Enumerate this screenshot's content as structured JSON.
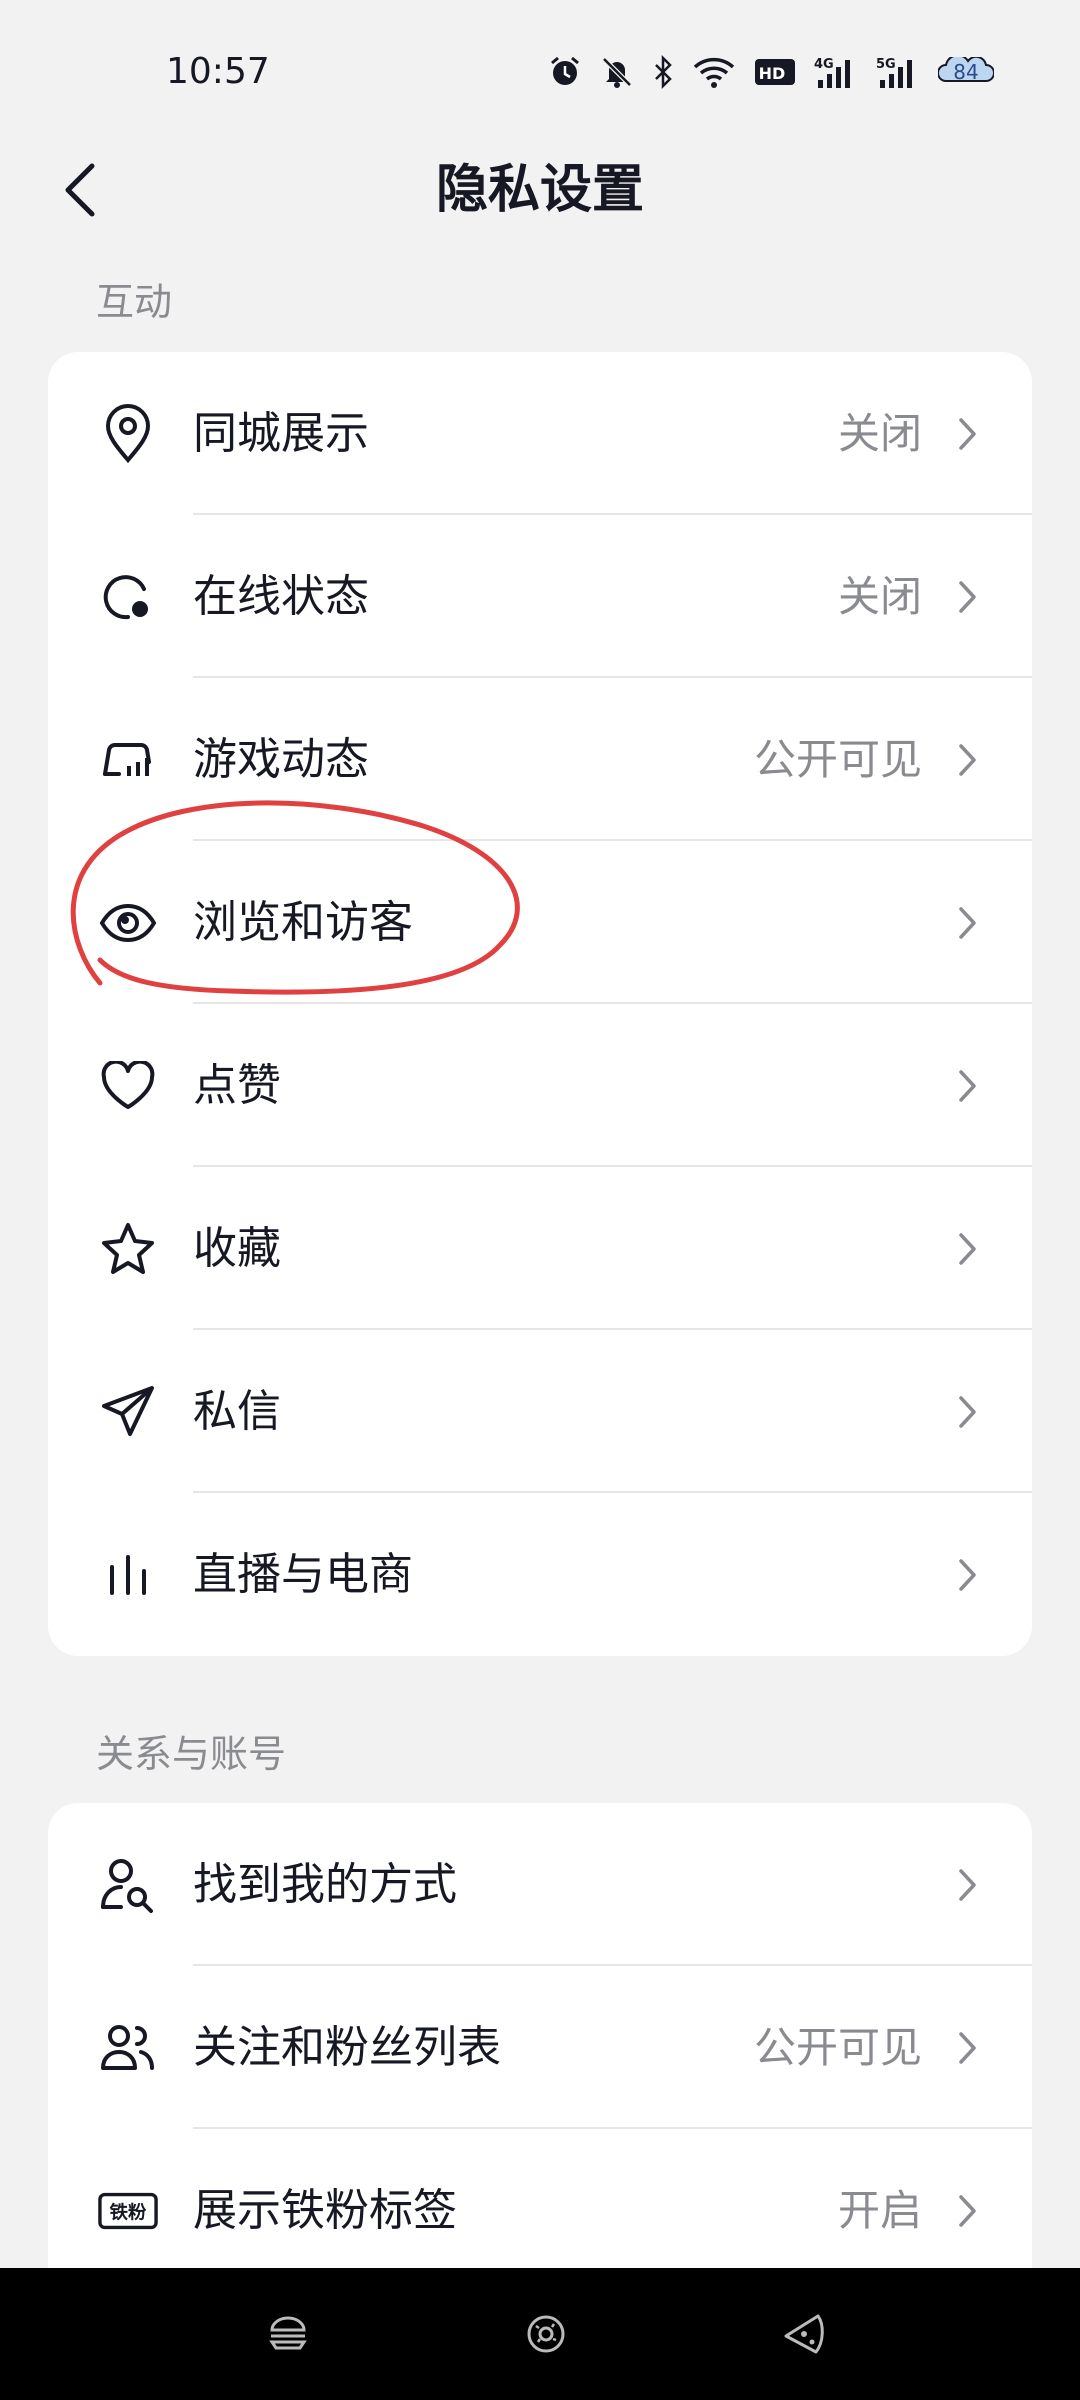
{
  "status": {
    "time": "10:57",
    "battery": "84"
  },
  "header": {
    "title": "隐私设置"
  },
  "sections": [
    {
      "title": "互动",
      "items": [
        {
          "label": "同城展示",
          "value": "关闭"
        },
        {
          "label": "在线状态",
          "value": "关闭"
        },
        {
          "label": "游戏动态",
          "value": "公开可见"
        },
        {
          "label": "浏览和访客",
          "value": ""
        },
        {
          "label": "点赞",
          "value": ""
        },
        {
          "label": "收藏",
          "value": ""
        },
        {
          "label": "私信",
          "value": ""
        },
        {
          "label": "直播与电商",
          "value": ""
        }
      ]
    },
    {
      "title": "关系与账号",
      "items": [
        {
          "label": "找到我的方式",
          "value": ""
        },
        {
          "label": "关注和粉丝列表",
          "value": "公开可见"
        },
        {
          "label": "展示铁粉标签",
          "value": "开启"
        }
      ]
    }
  ],
  "icons": {
    "status": [
      "alarm-icon",
      "bell-off-icon",
      "bluetooth-icon",
      "wifi-icon",
      "hd-icon",
      "signal-4g-icon",
      "signal-5g-icon",
      "battery-icon"
    ],
    "rows": [
      "location-pin-icon",
      "online-status-icon",
      "game-controller-icon",
      "eye-icon",
      "heart-icon",
      "star-icon",
      "paper-plane-icon",
      "live-bars-icon",
      "find-person-icon",
      "users-icon",
      "iron-fan-badge-icon"
    ],
    "badge_text": "铁粉"
  },
  "colors": {
    "background": "#f2f2f2",
    "card": "#ffffff",
    "text": "#161823",
    "secondary": "#8a8b91",
    "annotation": "#e04040"
  }
}
